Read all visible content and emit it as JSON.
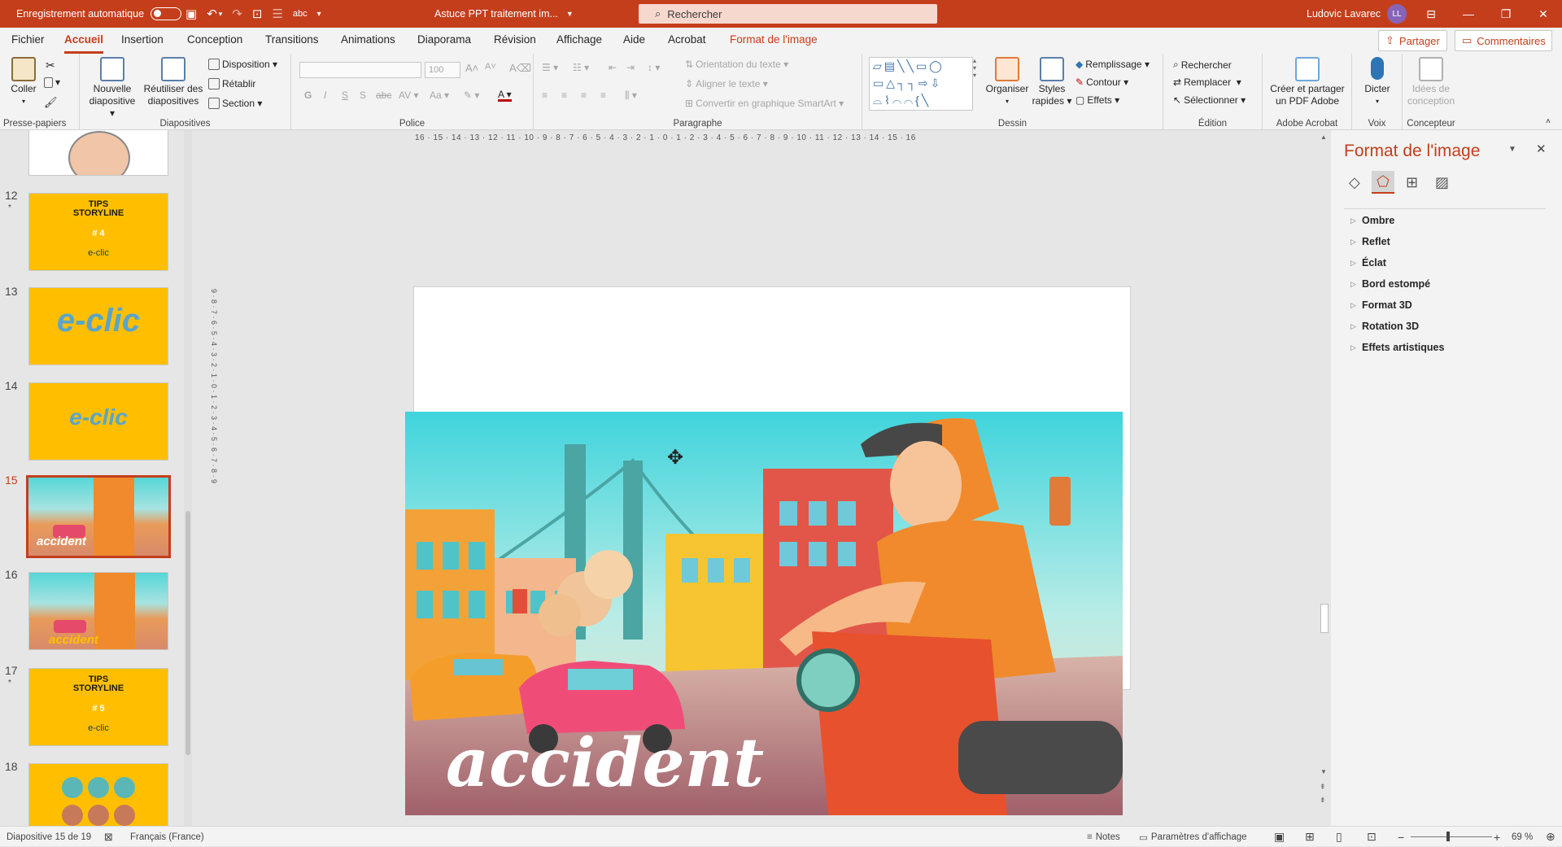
{
  "titlebar": {
    "autosave_label": "Enregistrement automatique",
    "doc_title": "Astuce PPT traitement im...",
    "search_placeholder": "Rechercher",
    "user_name": "Ludovic Lavarec",
    "user_initials": "LL"
  },
  "menu": {
    "tabs": [
      "Fichier",
      "Accueil",
      "Insertion",
      "Conception",
      "Transitions",
      "Animations",
      "Diaporama",
      "Révision",
      "Affichage",
      "Aide",
      "Acrobat",
      "Format de l'image"
    ],
    "active_tab": "Accueil",
    "share": "Partager",
    "comments": "Commentaires"
  },
  "ribbon": {
    "clipboard": {
      "paste": "Coller",
      "group": "Presse-papiers"
    },
    "slides": {
      "new_slide_1": "Nouvelle",
      "new_slide_2": "diapositive",
      "reuse_1": "Réutiliser des",
      "reuse_2": "diapositives",
      "layout": "Disposition",
      "reset": "Rétablir",
      "section": "Section",
      "group": "Diapositives"
    },
    "font": {
      "size": "100",
      "group": "Police"
    },
    "paragraph": {
      "text_direction": "Orientation du texte",
      "align_text": "Aligner le texte",
      "smartart": "Convertir en graphique SmartArt",
      "group": "Paragraphe"
    },
    "drawing": {
      "arrange": "Organiser",
      "quick_styles_1": "Styles",
      "quick_styles_2": "rapides",
      "fill": "Remplissage",
      "outline": "Contour",
      "effects": "Effets",
      "group": "Dessin"
    },
    "editing": {
      "find": "Rechercher",
      "replace": "Remplacer",
      "select": "Sélectionner",
      "group": "Édition"
    },
    "acrobat": {
      "create_1": "Créer et partager",
      "create_2": "un PDF Adobe",
      "group": "Adobe Acrobat"
    },
    "voice": {
      "dictate": "Dicter",
      "group": "Voix"
    },
    "designer": {
      "ideas_1": "Idées de",
      "ideas_2": "conception",
      "group": "Concepteur"
    }
  },
  "thumbnails": [
    {
      "num": "12",
      "star": "*",
      "kind": "tips",
      "line1": "TIPS",
      "line2": "STORYLINE",
      "line3": "# 4",
      "brand": "e-clic"
    },
    {
      "num": "13",
      "kind": "logo",
      "text": "e-clic"
    },
    {
      "num": "14",
      "kind": "logo",
      "text": "e-clic"
    },
    {
      "num": "15",
      "kind": "scene",
      "caption": "accident",
      "selected": true
    },
    {
      "num": "16",
      "kind": "scene",
      "caption": "accident"
    },
    {
      "num": "17",
      "star": "*",
      "kind": "tips",
      "line1": "TIPS",
      "line2": "STORYLINE",
      "line3": "# 5",
      "brand": "e-clic"
    },
    {
      "num": "18",
      "kind": "icons"
    }
  ],
  "slide": {
    "picture_caption": "accident"
  },
  "ruler": {
    "horizontal": "16 · 15 · 14 · 13 · 12 · 11 · 10 · 9 · 8 · 7 · 6 · 5 · 4 · 3 · 2 · 1 · 0 · 1 · 2 · 3 · 4 · 5 · 6 · 7 · 8 · 9 · 10 · 11 · 12 · 13 · 14 · 15 · 16",
    "vertical": "9 · 8 · 7 · 6 · 5 · 4 · 3 · 2 · 1 · 0 · 1 · 2 · 3 · 4 · 5 · 6 · 7 · 8 · 9"
  },
  "format_pane": {
    "title": "Format de l'image",
    "sections": [
      "Ombre",
      "Reflet",
      "Éclat",
      "Bord estompé",
      "Format 3D",
      "Rotation 3D",
      "Effets artistiques"
    ]
  },
  "status": {
    "slide_info": "Diapositive 15 de 19",
    "language": "Français (France)",
    "notes": "Notes",
    "display_settings": "Paramètres d'affichage",
    "zoom": "69 %"
  },
  "colors": {
    "accent": "#c43e1c",
    "thumb_yellow": "#ffbf00"
  }
}
